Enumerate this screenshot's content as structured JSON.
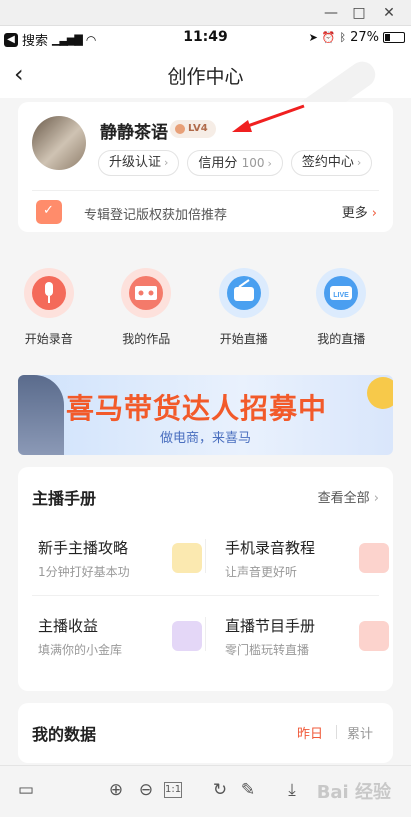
{
  "window": {
    "minimize": "—",
    "maximize": "□",
    "close": "✕"
  },
  "status_bar": {
    "back_app": "搜索",
    "time": "11:49",
    "battery": "27%",
    "battery_level": 0.27
  },
  "nav": {
    "title": "创作中心",
    "back_icon": "chevron-left-icon"
  },
  "profile": {
    "username": "静静茶语",
    "level": "LV4",
    "pills": [
      {
        "label": "升级认证",
        "value": ""
      },
      {
        "label": "信用分",
        "value": "100"
      },
      {
        "label": "签约中心",
        "value": ""
      }
    ],
    "promo_text": "专辑登记版权获加倍推荐",
    "more_label": "更多"
  },
  "quick_actions": [
    {
      "label": "开始录音",
      "icon": "microphone-icon",
      "color": "#f46a5a"
    },
    {
      "label": "我的作品",
      "icon": "cassette-icon",
      "color": "#f47a6a"
    },
    {
      "label": "开始直播",
      "icon": "radio-icon",
      "color": "#4aa0f0"
    },
    {
      "label": "我的直播",
      "icon": "live-tv-icon",
      "color": "#4a9ef0"
    }
  ],
  "banner": {
    "title": "喜马带货达人招募中",
    "subtitle": "做电商，来喜马"
  },
  "guide": {
    "title": "主播手册",
    "view_all": "查看全部",
    "items": [
      {
        "title": "新手主播攻略",
        "subtitle": "1分钟打好基本功",
        "icon": "guide-book-icon",
        "color": "#f7c94a"
      },
      {
        "title": "手机录音教程",
        "subtitle": "让声音更好听",
        "icon": "phone-record-icon",
        "color": "#f45a4a"
      },
      {
        "title": "主播收益",
        "subtitle": "填满你的小金库",
        "icon": "wallet-icon",
        "color": "#9a6ae0"
      },
      {
        "title": "直播节目手册",
        "subtitle": "零门槛玩转直播",
        "icon": "manual-icon",
        "color": "#f46a4a"
      }
    ]
  },
  "data_section": {
    "title": "我的数据",
    "tab_yesterday": "昨日",
    "tab_total": "累计"
  },
  "toolbar": {
    "buttons": [
      "panel-toggle-icon",
      "zoom-in-icon",
      "zoom-out-icon",
      "actual-size-icon",
      "rotate-icon",
      "edit-icon",
      "download-icon"
    ],
    "actual_size_label": "1:1",
    "watermark": "Bai 经验"
  }
}
